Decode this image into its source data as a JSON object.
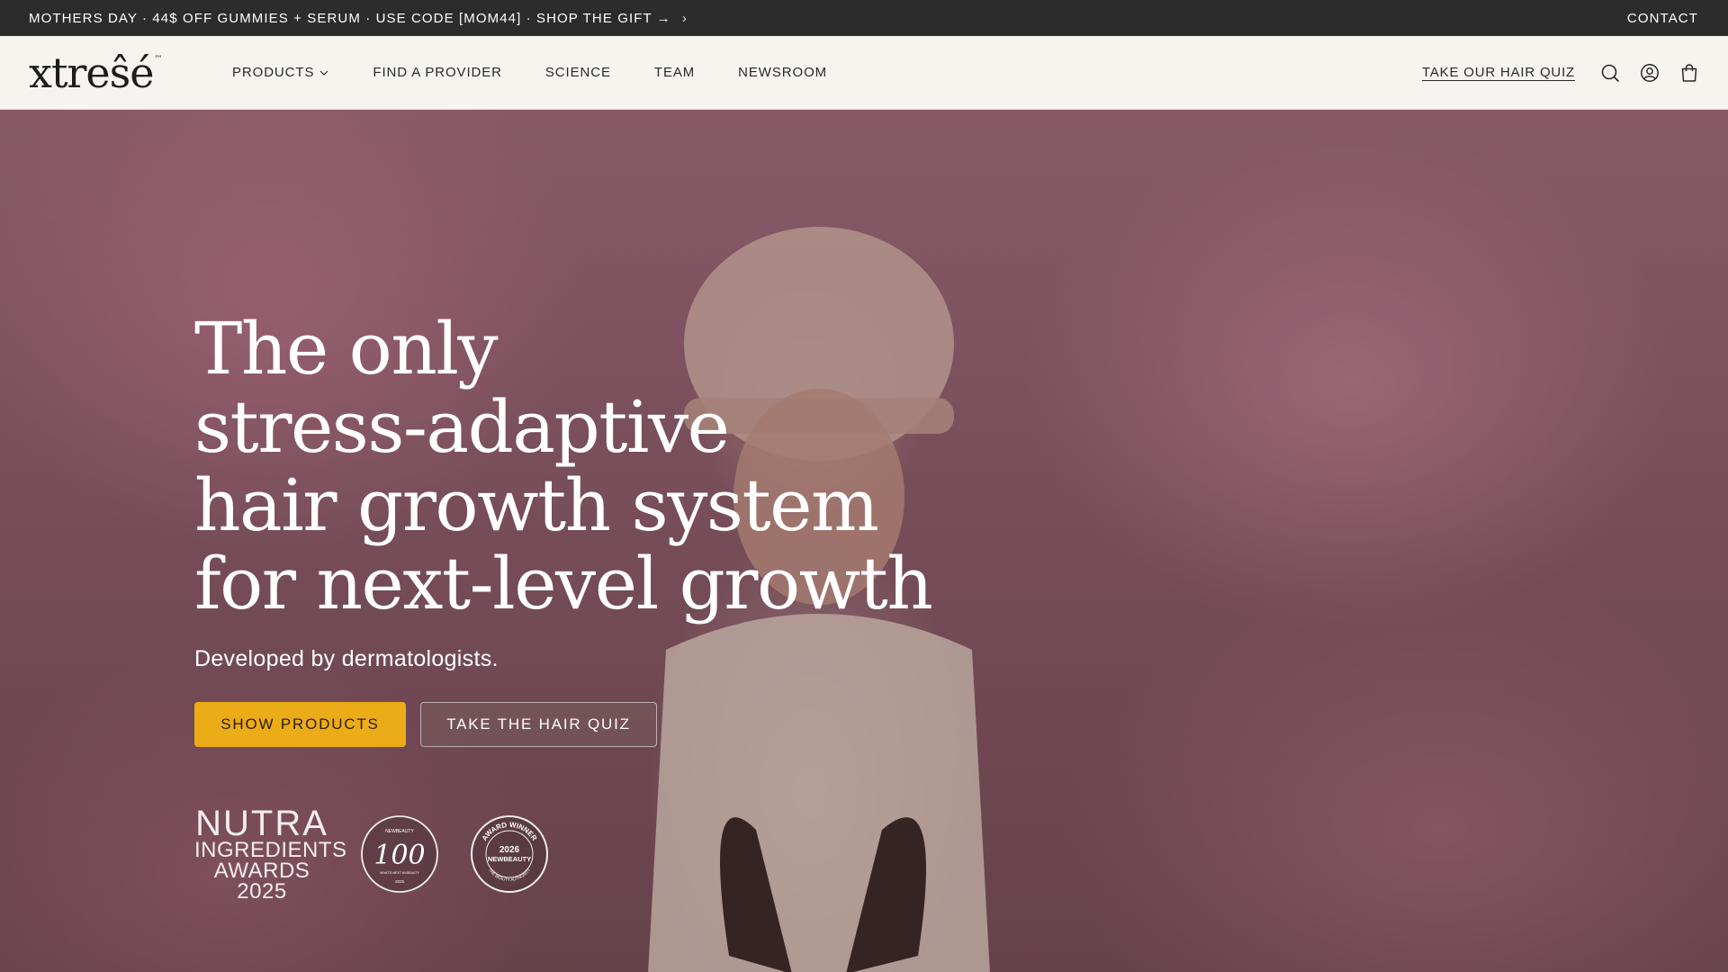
{
  "announcement": {
    "text": "MOTHERS DAY · 44$ OFF GUMMIES + SERUM · USE CODE [MOM44] · SHOP THE GIFT →",
    "chevron_icon": "chevron-right-icon",
    "contact_label": "CONTACT"
  },
  "header": {
    "logo_text": "xtreŝé",
    "logo_tm": "™",
    "nav": [
      {
        "label": "PRODUCTS",
        "has_dropdown": true
      },
      {
        "label": "FIND A PROVIDER"
      },
      {
        "label": "SCIENCE"
      },
      {
        "label": "TEAM"
      },
      {
        "label": "NEWSROOM"
      }
    ],
    "quiz_link": "TAKE OUR HAIR QUIZ",
    "icons": [
      "search-icon",
      "account-icon",
      "cart-icon"
    ]
  },
  "hero": {
    "headline": [
      "The only",
      "stress-adaptive",
      "hair growth system",
      "for next-level growth"
    ],
    "subline": "Developed by dermatologists.",
    "primary_cta": "SHOW PRODUCTS",
    "secondary_cta": "TAKE THE HAIR QUIZ",
    "awards": {
      "nutra": [
        "NUTRA",
        "INGREDIENTS",
        "AWARDS 2025"
      ],
      "badge_100": {
        "top": "NEWBEAUTY",
        "number": "100",
        "bottom": "WHAT'S NEXT IN BEAUTY",
        "year": "2025"
      },
      "badge_winner": {
        "arc_top": "AWARD WINNER",
        "year": "2026",
        "brand": "NEWBEAUTY",
        "arc_bottom": "THE BEAUTY AUTHORITY"
      }
    }
  },
  "colors": {
    "announcement_bg": "#2d2c2c",
    "header_bg": "#f7f4ef",
    "primary_button": "#ebac17",
    "hero_tint": "#a56e7e"
  }
}
